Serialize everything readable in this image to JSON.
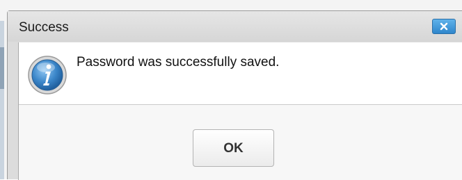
{
  "dialog": {
    "title": "Success",
    "close_icon": "close-icon",
    "info_icon": "info-icon",
    "message": "Password was successfully saved.",
    "ok_label": "OK"
  },
  "colors": {
    "close_button": "#3f9be0",
    "info_icon": "#3b86c9"
  }
}
